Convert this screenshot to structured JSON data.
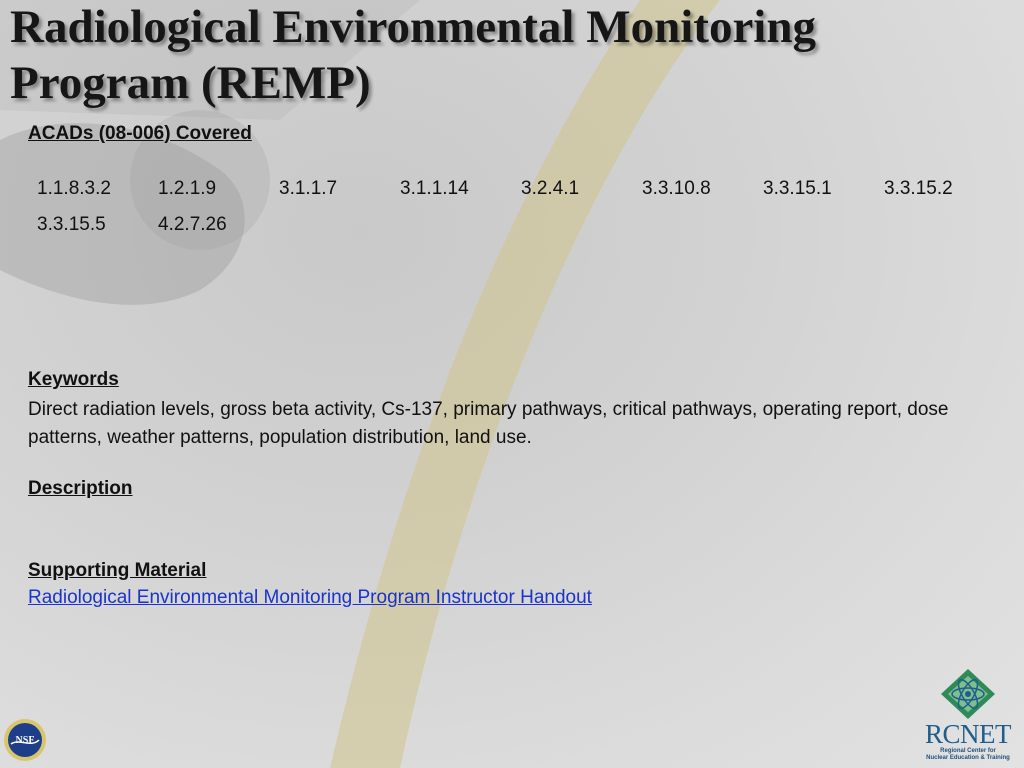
{
  "title": {
    "line1": "Radiological Environmental Monitoring",
    "line2": "Program (REMP)"
  },
  "acads": {
    "heading": "ACADs (08-006)  Covered",
    "codes": [
      "1.1.8.3.2",
      "1.2.1.9",
      "3.1.1.7",
      "3.1.1.14",
      "3.2.4.1",
      "3.3.10.8",
      "3.3.15.1",
      "3.3.15.2",
      "3.3.15.5",
      "4.2.7.26"
    ]
  },
  "keywords": {
    "heading": "Keywords",
    "text": "Direct radiation levels, gross beta activity, Cs-137, primary pathways, critical pathways, operating report, dose patterns, weather patterns, population distribution, land use."
  },
  "description": {
    "heading": "Description"
  },
  "supporting": {
    "heading": "Supporting Material",
    "link_text": "Radiological Environmental Monitoring Program Instructor Handout"
  },
  "logos": {
    "nsf": "NSF",
    "rcnet_name": "RCNET",
    "rcnet_tagline_1": "Regional Center for",
    "rcnet_tagline_2": "Nuclear Education & Training"
  },
  "colors": {
    "link": "#1a33cc",
    "rcnet_blue": "#1f5d8c",
    "rcnet_green": "#2e8b57",
    "arc_yellow": "#c9be6e"
  }
}
